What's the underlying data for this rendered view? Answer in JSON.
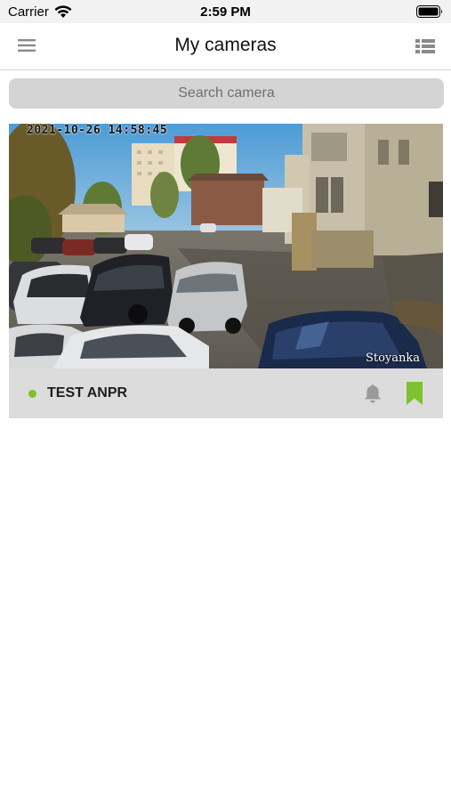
{
  "status_bar": {
    "carrier": "Carrier",
    "time": "2:59 PM"
  },
  "nav": {
    "title": "My cameras",
    "menu_icon": "hamburger-menu-icon",
    "view_icon": "list-view-icon"
  },
  "search": {
    "placeholder": "Search camera",
    "value": ""
  },
  "cameras": [
    {
      "name": "TEST ANPR",
      "status": "online",
      "status_color": "#7dc12d",
      "preview_timestamp": "2021-10-26 14:58:45",
      "preview_overlay_label": "Stoyanka",
      "alert_icon": "bell-icon",
      "bookmark_icon": "bookmark-icon",
      "bookmarked": true,
      "bookmark_color": "#7dc12d"
    }
  ],
  "colors": {
    "accent": "#7dc12d",
    "search_bg": "#d4d4d4",
    "card_footer_bg": "#dcdcdc",
    "icon_gray": "#9a9a9a"
  }
}
